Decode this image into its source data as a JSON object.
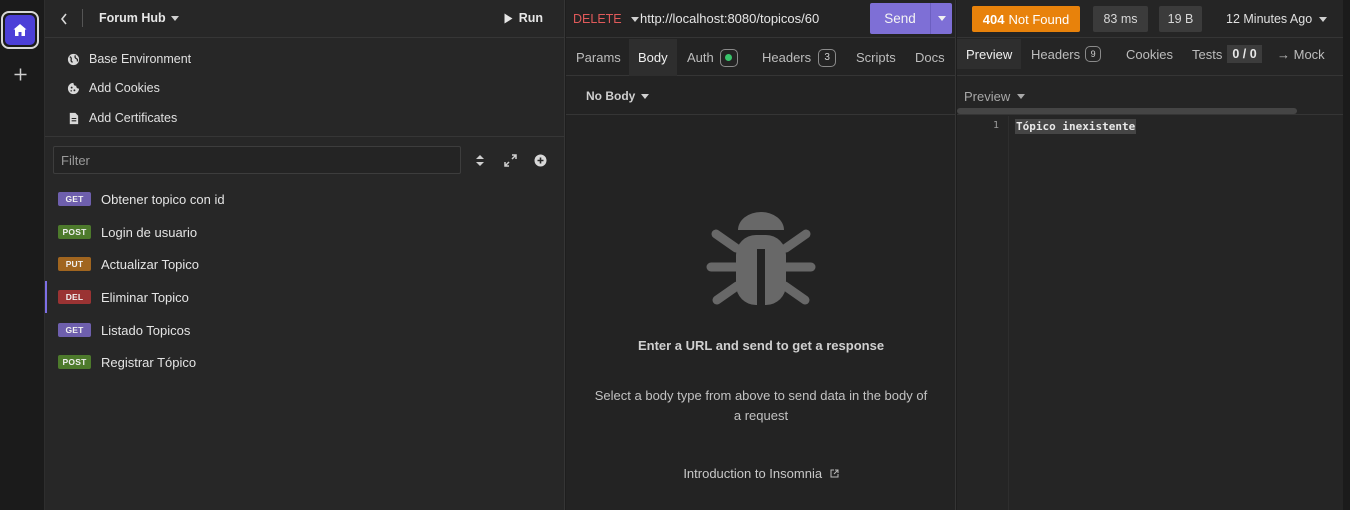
{
  "sidebar": {
    "project_name": "Forum Hub",
    "run_label": "Run",
    "links": [
      {
        "label": "Base Environment",
        "icon": "globe-icon"
      },
      {
        "label": "Add Cookies",
        "icon": "cookie-icon"
      },
      {
        "label": "Add Certificates",
        "icon": "certificate-icon"
      }
    ],
    "filter_placeholder": "Filter",
    "requests": [
      {
        "method": "GET",
        "name": "Obtener topico con id",
        "color": "#6e5fad"
      },
      {
        "method": "POST",
        "name": "Login de usuario",
        "color": "#4d7a2c"
      },
      {
        "method": "PUT",
        "name": "Actualizar Topico",
        "color": "#a0651f"
      },
      {
        "method": "DEL",
        "name": "Eliminar Topico",
        "color": "#9a3333"
      },
      {
        "method": "GET",
        "name": "Listado Topicos",
        "color": "#6e5fad"
      },
      {
        "method": "POST",
        "name": "Registrar Tópico",
        "color": "#4d7a2c"
      }
    ]
  },
  "request": {
    "method": "DELETE",
    "url": "http://localhost:8080/topicos/60",
    "send_label": "Send",
    "tabs": {
      "params": "Params",
      "body": "Body",
      "auth": "Auth",
      "headers": "Headers",
      "headers_count": "3",
      "scripts": "Scripts",
      "docs": "Docs"
    },
    "body_type": "No Body",
    "empty_title": "Enter a URL and send to get a response",
    "empty_desc": "Select a body type from above to send data in the body of a request",
    "intro_link": "Introduction to Insomnia"
  },
  "response": {
    "status_code": "404",
    "status_text": "Not Found",
    "time": "83 ms",
    "size": "19 B",
    "ago": "12 Minutes Ago",
    "tabs": {
      "preview": "Preview",
      "headers": "Headers",
      "headers_count": "9",
      "cookies": "Cookies",
      "tests": "Tests",
      "tests_count": "0 / 0",
      "mock": "→ Mock"
    },
    "preview_mode": "Preview",
    "line_number": "1",
    "body_text": "Tópico inexistente"
  },
  "colors": {
    "accent": "#7e6fd6",
    "home": "#4c3fd8",
    "status_404": "#e8820b",
    "delete_method": "#e05a5a"
  }
}
